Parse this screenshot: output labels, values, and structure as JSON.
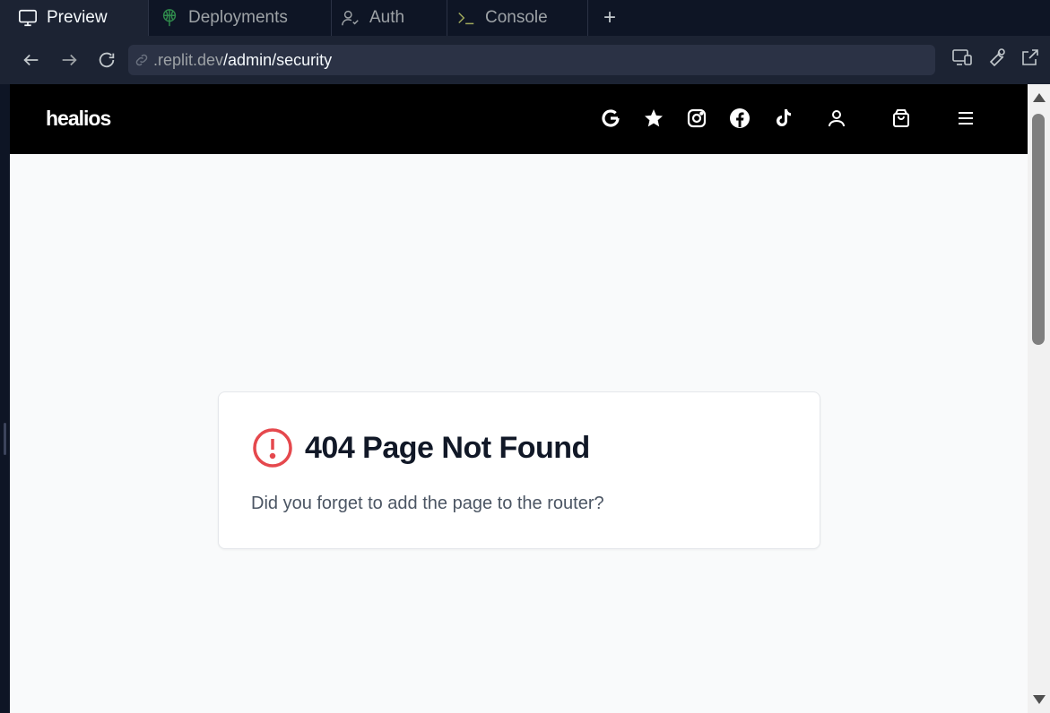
{
  "tabs": [
    {
      "label": "Preview",
      "icon": "monitor-icon"
    },
    {
      "label": "Deployments",
      "icon": "deploy-icon"
    },
    {
      "label": "Auth",
      "icon": "user-check-icon"
    },
    {
      "label": "Console",
      "icon": "terminal-icon"
    }
  ],
  "add_tab": "+",
  "url": {
    "domain": ".replit.dev",
    "path": "/admin/security"
  },
  "site": {
    "logo": "healios",
    "header_icons": [
      "google-icon",
      "star-icon",
      "instagram-icon",
      "facebook-icon",
      "tiktok-icon",
      "user-icon",
      "shopping-bag-icon",
      "menu-icon"
    ]
  },
  "error": {
    "title": "404 Page Not Found",
    "message": "Did you forget to add the page to the router?",
    "icon": "alert-circle-icon"
  },
  "colors": {
    "accent": "#e5484d",
    "header_bg": "#000000",
    "ide_bg": "#0e1525"
  }
}
